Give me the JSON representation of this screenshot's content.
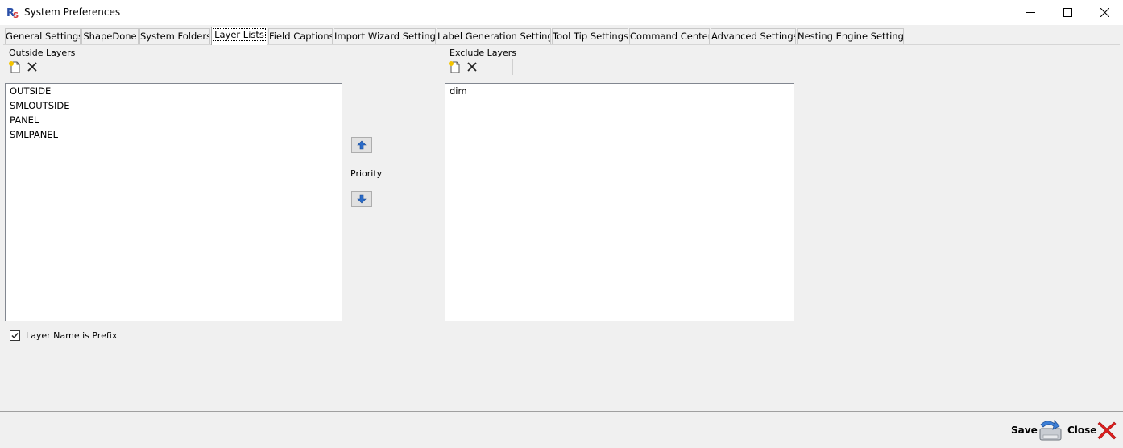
{
  "window": {
    "title": "System Preferences"
  },
  "tabs": [
    {
      "label": "General Settings"
    },
    {
      "label": "ShapeDone"
    },
    {
      "label": "System Folders"
    },
    {
      "label": "Layer Lists"
    },
    {
      "label": "Field Captions"
    },
    {
      "label": "Import Wizard Settings"
    },
    {
      "label": "Label Generation Settings"
    },
    {
      "label": "Tool Tip Settings"
    },
    {
      "label": "Command Center"
    },
    {
      "label": "Advanced Settings"
    },
    {
      "label": "Nesting Engine Settings"
    }
  ],
  "active_tab": "Layer Lists",
  "outside_layers": {
    "label": "Outside Layers",
    "items": [
      "OUTSIDE",
      "SMLOUTSIDE",
      "PANEL",
      "SMLPANEL"
    ]
  },
  "priority": {
    "label": "Priority"
  },
  "exclude_layers": {
    "label": "Exclude Layers",
    "items": [
      "dim"
    ]
  },
  "prefix_checkbox": {
    "label": "Layer Name is Prefix",
    "checked": true
  },
  "footer": {
    "save_label": "Save",
    "close_label": "Close"
  },
  "icons": {
    "new": "new-document-icon",
    "delete": "delete-x-icon",
    "up": "arrow-up-icon",
    "down": "arrow-down-icon",
    "save": "save-disk-icon",
    "close": "close-red-x-icon"
  },
  "colors": {
    "close_x": "#e01e1e",
    "arrow_blue": "#2a6bc9"
  }
}
